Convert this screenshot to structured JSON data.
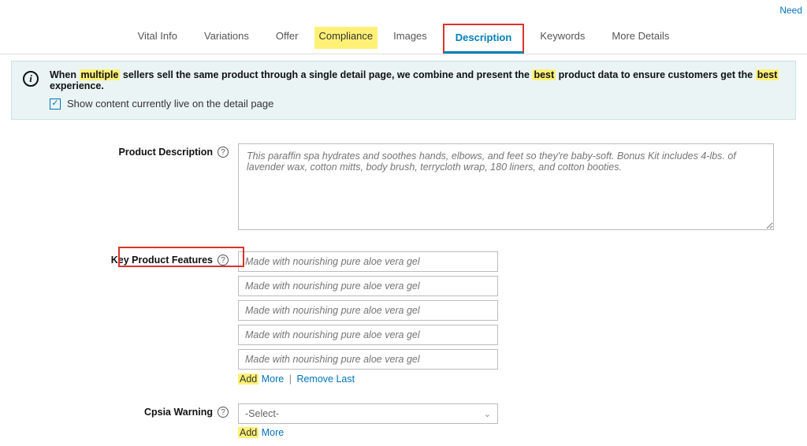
{
  "topRight": "Need",
  "tabs": {
    "vitalInfo": "Vital Info",
    "variations": "Variations",
    "offer": "Offer",
    "compliance": "Compliance",
    "images": "Images",
    "description": "Description",
    "keywords": "Keywords",
    "moreDetails": "More Details"
  },
  "info": {
    "prefix": "When ",
    "multiple": "multiple",
    "mid1": " sellers sell the same product through a single detail page, we combine and present the ",
    "best1": "best",
    "mid2": " product data to ensure customers get the ",
    "best2": "best",
    "suffix": " experience.",
    "checkboxLabel": "Show content currently live on the detail page"
  },
  "labels": {
    "productDescription": "Product Description",
    "keyFeatures": "Key Product Features",
    "cpsia": "Cpsia Warning"
  },
  "productDescriptionPlaceholder": "This paraffin spa hydrates and soothes hands, elbows, and feet so they're baby-soft. Bonus Kit includes 4-lbs. of lavender wax, cotton mitts, body brush, terrycloth wrap, 180 liners, and cotton booties.",
  "features": [
    "Made with nourishing pure aloe vera gel",
    "Made with nourishing pure aloe vera gel",
    "Made with nourishing pure aloe vera gel",
    "Made with nourishing pure aloe vera gel",
    "Made with nourishing pure aloe vera gel"
  ],
  "links": {
    "add": "Add",
    "more": "More",
    "removeLast": "Remove Last"
  },
  "cpsia": {
    "selected": "-Select-"
  }
}
